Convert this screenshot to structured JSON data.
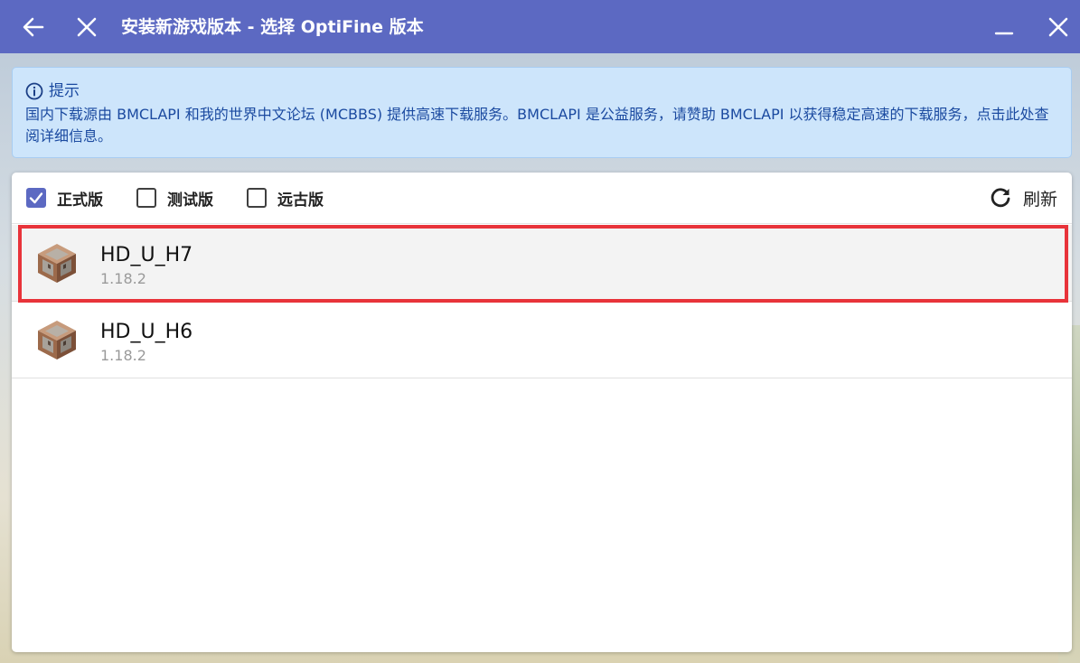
{
  "titlebar": {
    "title": "安装新游戏版本 - 选择 OptiFine 版本",
    "back_icon": "arrow-left-icon",
    "close_icon": "close-icon",
    "minimize_icon": "minimize-icon",
    "window_close_icon": "close-icon",
    "color": "#5c69c2"
  },
  "hint": {
    "heading": "提示",
    "body": "国内下载源由 BMCLAPI 和我的世界中文论坛 (MCBBS) 提供高速下载服务。BMCLAPI 是公益服务，请赞助 BMCLAPI 以获得稳定高速的下载服务，点击此处查阅详细信息。",
    "icon": "info-icon"
  },
  "filters": {
    "release": {
      "label": "正式版",
      "checked": true
    },
    "snapshot": {
      "label": "测试版",
      "checked": false
    },
    "old": {
      "label": "远古版",
      "checked": false
    },
    "refresh_label": "刷新",
    "refresh_icon": "refresh-icon"
  },
  "versions": [
    {
      "name": "HD_U_H7",
      "game_version": "1.18.2",
      "icon": "command-block-icon",
      "selected": true
    },
    {
      "name": "HD_U_H6",
      "game_version": "1.18.2",
      "icon": "command-block-icon",
      "selected": false
    }
  ],
  "highlight_color": "#e8333a"
}
